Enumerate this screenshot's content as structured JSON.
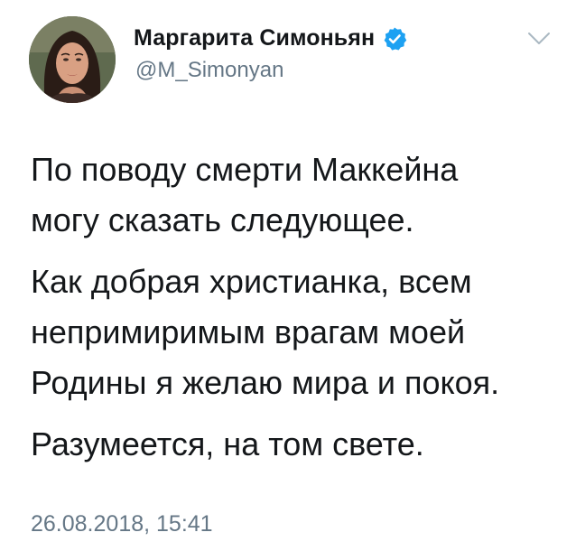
{
  "author": {
    "display_name": "Маргарита Симоньян",
    "handle": "@M_Simonyan",
    "verified": true,
    "avatar": "profile-photo"
  },
  "tweet": {
    "paragraphs": [
      {
        "lines": [
          "По поводу смерти Маккейна",
          "могу сказать следующее."
        ]
      },
      {
        "lines": [
          "Как добрая христианка, всем",
          "непримиримым врагам моей",
          "Родины я желаю мира и покоя."
        ]
      },
      {
        "lines": [
          "Разумеется, на том свете."
        ]
      }
    ],
    "timestamp": "26.08.2018, 15:41"
  },
  "icons": {
    "verified": "verified-badge-icon",
    "menu": "chevron-down-icon"
  },
  "colors": {
    "verified_blue": "#1da1f2",
    "secondary_text": "#657786",
    "primary_text": "#14171a"
  }
}
